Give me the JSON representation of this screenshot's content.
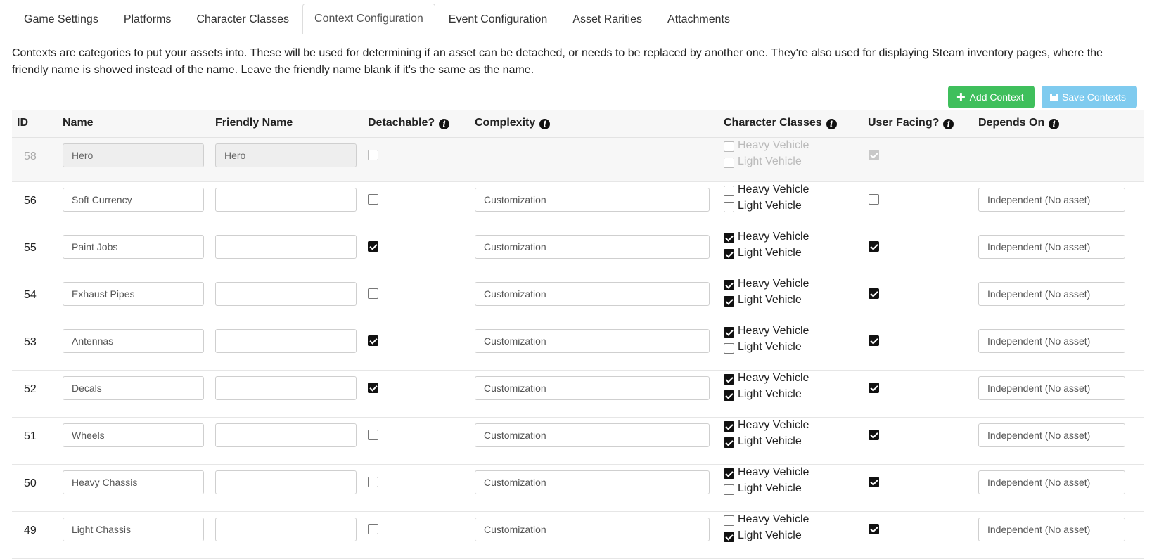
{
  "tabs": [
    {
      "label": "Game Settings",
      "active": false
    },
    {
      "label": "Platforms",
      "active": false
    },
    {
      "label": "Character Classes",
      "active": false
    },
    {
      "label": "Context Configuration",
      "active": true
    },
    {
      "label": "Event Configuration",
      "active": false
    },
    {
      "label": "Asset Rarities",
      "active": false
    },
    {
      "label": "Attachments",
      "active": false
    }
  ],
  "description_line1": "Contexts are categories to put your assets into. These will be used for determining if an asset can be detached, or needs to be replaced by another one. They're also used for displaying Steam inventory pages, where the",
  "description_line2": "friendly name is showed instead of the name. Leave the friendly name blank if it's the same as the name.",
  "buttons": {
    "add_context": "Add Context",
    "save_contexts": "Save Contexts"
  },
  "headers": {
    "id": "ID",
    "name": "Name",
    "friendly_name": "Friendly Name",
    "detachable": "Detachable?",
    "complexity": "Complexity",
    "character_classes": "Character Classes",
    "user_facing": "User Facing?",
    "depends_on": "Depends On"
  },
  "class_names": [
    "Heavy Vehicle",
    "Light Vehicle"
  ],
  "rows": [
    {
      "id": "58",
      "name": "Hero",
      "friendly": "Hero",
      "detachable": false,
      "complexity": "",
      "heavy": false,
      "light": false,
      "user_facing": true,
      "depends": "",
      "disabled": true
    },
    {
      "id": "56",
      "name": "Soft Currency",
      "friendly": "",
      "detachable": false,
      "complexity": "Customization",
      "heavy": false,
      "light": false,
      "user_facing": false,
      "depends": "Independent (No asset)",
      "disabled": false
    },
    {
      "id": "55",
      "name": "Paint Jobs",
      "friendly": "",
      "detachable": true,
      "complexity": "Customization",
      "heavy": true,
      "light": true,
      "user_facing": true,
      "depends": "Independent (No asset)",
      "disabled": false
    },
    {
      "id": "54",
      "name": "Exhaust Pipes",
      "friendly": "",
      "detachable": false,
      "complexity": "Customization",
      "heavy": true,
      "light": true,
      "user_facing": true,
      "depends": "Independent (No asset)",
      "disabled": false
    },
    {
      "id": "53",
      "name": "Antennas",
      "friendly": "",
      "detachable": true,
      "complexity": "Customization",
      "heavy": true,
      "light": false,
      "user_facing": true,
      "depends": "Independent (No asset)",
      "disabled": false
    },
    {
      "id": "52",
      "name": "Decals",
      "friendly": "",
      "detachable": true,
      "complexity": "Customization",
      "heavy": true,
      "light": true,
      "user_facing": true,
      "depends": "Independent (No asset)",
      "disabled": false
    },
    {
      "id": "51",
      "name": "Wheels",
      "friendly": "",
      "detachable": false,
      "complexity": "Customization",
      "heavy": true,
      "light": true,
      "user_facing": true,
      "depends": "Independent (No asset)",
      "disabled": false
    },
    {
      "id": "50",
      "name": "Heavy Chassis",
      "friendly": "",
      "detachable": false,
      "complexity": "Customization",
      "heavy": true,
      "light": false,
      "user_facing": true,
      "depends": "Independent (No asset)",
      "disabled": false
    },
    {
      "id": "49",
      "name": "Light Chassis",
      "friendly": "",
      "detachable": false,
      "complexity": "Customization",
      "heavy": false,
      "light": true,
      "user_facing": true,
      "depends": "Independent (No asset)",
      "disabled": false
    }
  ]
}
